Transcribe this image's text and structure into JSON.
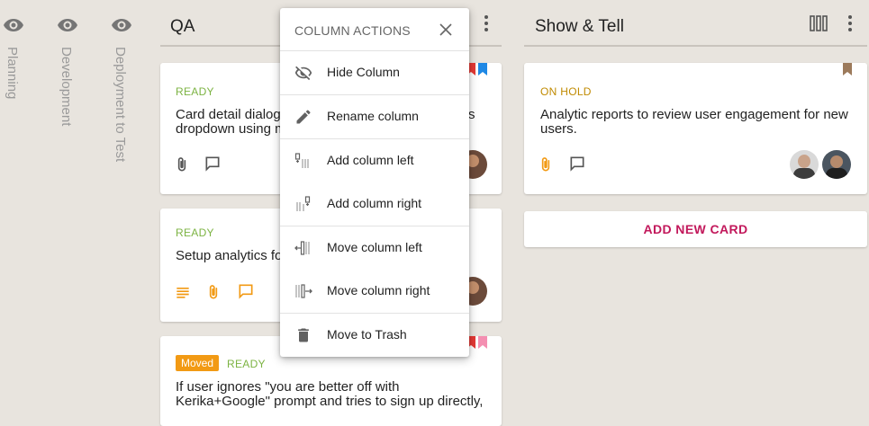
{
  "collapsed_columns": [
    {
      "label": "Planning",
      "icon": "eye-icon"
    },
    {
      "label": "Development",
      "icon": "eye-icon"
    },
    {
      "label": "Deployment to Test",
      "icon": "eye-icon"
    }
  ],
  "columns": {
    "qa": {
      "title": "QA",
      "cards": [
        {
          "status": "READY",
          "text_line1": "Card detail dialog",
          "text_line2": "dropdown using m",
          "text_tail": "s"
        },
        {
          "status": "READY",
          "text_line1": "Setup analytics fo"
        },
        {
          "badge": "Moved",
          "status": "READY",
          "text_line1": "If user ignores \"you are better off with",
          "text_line2": "Kerika+Google\" prompt and tries to sign up directly,"
        }
      ]
    },
    "show_tell": {
      "title": "Show & Tell",
      "cards": [
        {
          "status": "ON HOLD",
          "text_line1": "Analytic reports to review user engagement for new",
          "text_line2": "users."
        }
      ],
      "add_card_label": "ADD NEW CARD"
    }
  },
  "menu": {
    "title": "COLUMN ACTIONS",
    "items": [
      {
        "label": "Hide Column",
        "icon": "eye-off-icon"
      },
      {
        "label": "Rename column",
        "icon": "pencil-icon"
      },
      {
        "label": "Add column left",
        "icon": "add-column-left-icon"
      },
      {
        "label": "Add column right",
        "icon": "add-column-right-icon"
      },
      {
        "label": "Move column left",
        "icon": "move-column-left-icon"
      },
      {
        "label": "Move column right",
        "icon": "move-column-right-icon"
      },
      {
        "label": "Move to Trash",
        "icon": "trash-icon"
      }
    ]
  },
  "colors": {
    "background": "#e8e4de",
    "ready": "#7cb342",
    "on_hold": "#c08a00",
    "accent_orange": "#f29a14",
    "add_card": "#c2185b",
    "bookmark_red": "#e53935",
    "bookmark_blue": "#1e88e5",
    "bookmark_pink": "#f48fb1",
    "bookmark_brown": "#9c7a5b"
  }
}
